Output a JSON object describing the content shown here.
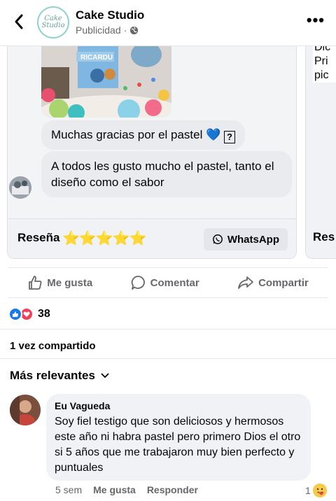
{
  "header": {
    "page_name": "Cake Studio",
    "sponsored": "Publicidad",
    "logo_text": "Cake Studio",
    "colors": {
      "accent": "#8fd3cf"
    }
  },
  "card": {
    "photo_caption": "RICARDU",
    "messages": [
      {
        "text": "Muchas gracias por el pastel",
        "emoji": "💙",
        "suffix": "?"
      },
      {
        "text": "A todos les gusto mucho el pastel, tanto el diseño como el sabor"
      }
    ],
    "footer_label": "Reseña",
    "stars": "⭐⭐⭐⭐⭐",
    "whatsapp_label": "WhatsApp"
  },
  "card2": {
    "text_lines": [
      "Dic",
      "Pri",
      "pic"
    ],
    "footer_label": "Res"
  },
  "actions": {
    "like": "Me gusta",
    "comment": "Comentar",
    "share": "Compartir"
  },
  "reactions": {
    "count": "38",
    "colors": {
      "like": "#1877f2",
      "love": "#f33e58"
    }
  },
  "shares": "1 vez compartido",
  "sort": {
    "label": "Más relevantes"
  },
  "comment": {
    "author": "Eu Vagueda",
    "text": "Soy fiel testigo que son deliciosos y hermosos este año ni habra pastel pero primero Dios el otro si 5 años que me trabajaron muy bien perfecto y puntuales",
    "time": "5 sem",
    "like": "Me gusta",
    "reply": "Responder",
    "reaction_count": "1"
  }
}
